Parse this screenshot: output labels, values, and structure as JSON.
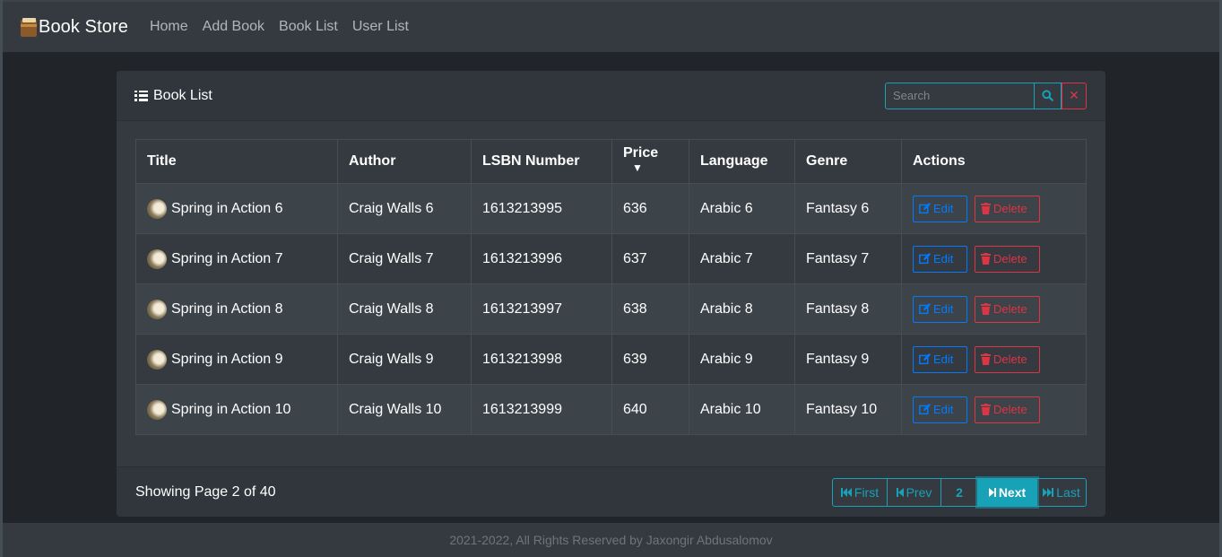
{
  "navbar": {
    "brand": "Book Store",
    "links": [
      "Home",
      "Add Book",
      "Book List",
      "User List"
    ]
  },
  "card": {
    "title": "Book List",
    "search": {
      "placeholder": "Search",
      "value": ""
    }
  },
  "table": {
    "headers": [
      "Title",
      "Author",
      "LSBN Number",
      "Price",
      "Language",
      "Genre",
      "Actions"
    ],
    "sort_column": "Price",
    "rows": [
      {
        "title": "Spring in Action 6",
        "author": "Craig Walls 6",
        "isbn": "1613213995",
        "price": "636",
        "language": "Arabic 6",
        "genre": "Fantasy 6"
      },
      {
        "title": "Spring in Action 7",
        "author": "Craig Walls 7",
        "isbn": "1613213996",
        "price": "637",
        "language": "Arabic 7",
        "genre": "Fantasy 7"
      },
      {
        "title": "Spring in Action 8",
        "author": "Craig Walls 8",
        "isbn": "1613213997",
        "price": "638",
        "language": "Arabic 8",
        "genre": "Fantasy 8"
      },
      {
        "title": "Spring in Action 9",
        "author": "Craig Walls 9",
        "isbn": "1613213998",
        "price": "639",
        "language": "Arabic 9",
        "genre": "Fantasy 9"
      },
      {
        "title": "Spring in Action 10",
        "author": "Craig Walls 10",
        "isbn": "1613213999",
        "price": "640",
        "language": "Arabic 10",
        "genre": "Fantasy 10"
      }
    ],
    "actions": {
      "edit_label": "Edit",
      "delete_label": "Delete"
    }
  },
  "pagination": {
    "info": "Showing Page 2 of 40",
    "first_label": "First",
    "prev_label": "Prev",
    "current_page": "2",
    "next_label": "Next",
    "last_label": "Last"
  },
  "footer": {
    "text": "2021-2022, All Rights Reserved by Jaxongir Abdusalomov"
  },
  "colors": {
    "accent_info": "#17a2b8",
    "accent_primary": "#007bff",
    "accent_danger": "#dc3545",
    "background": "#212529",
    "surface": "#343a40"
  }
}
